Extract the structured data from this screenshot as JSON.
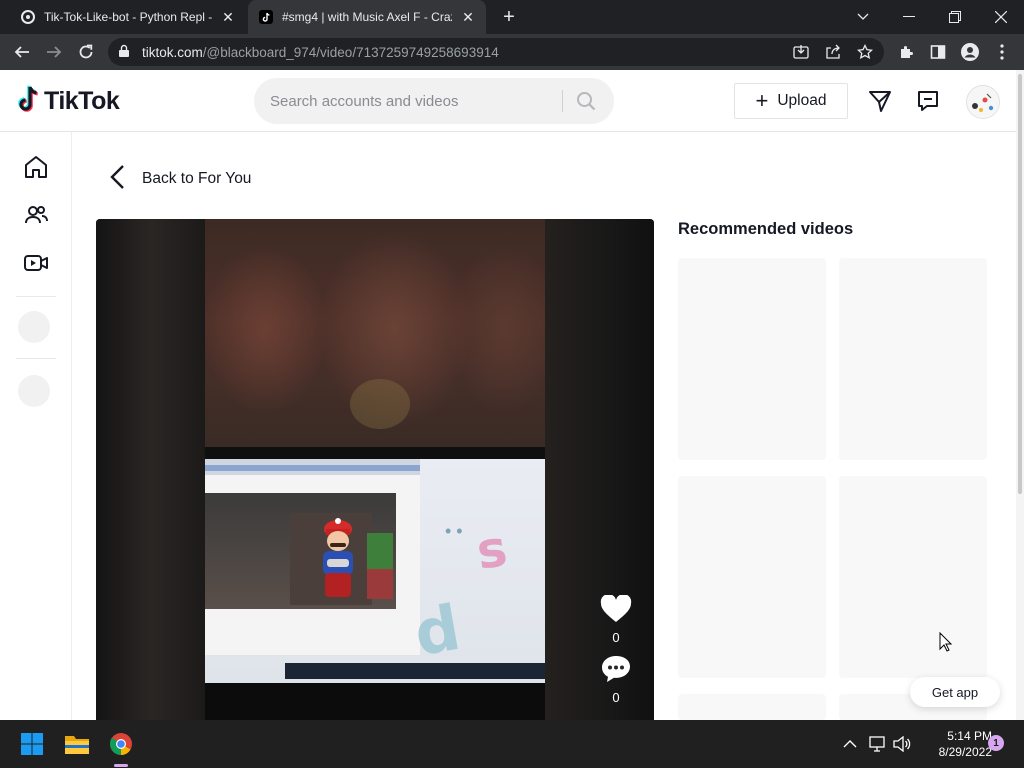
{
  "browser": {
    "tabs": [
      {
        "title": "Tik-Tok-Like-bot - Python Repl -",
        "active": false
      },
      {
        "title": "#smg4 | with Music Axel F - Craz",
        "active": true
      }
    ],
    "url": {
      "host": "tiktok.com",
      "path": "/@blackboard_974/video/7137259749258693914"
    }
  },
  "header": {
    "logo_text": "TikTok",
    "search_placeholder": "Search accounts and videos",
    "upload_label": "Upload"
  },
  "main": {
    "back_label": "Back to For You",
    "like_count": "0",
    "comment_count": "0",
    "recommended_title": "Recommended videos"
  },
  "get_app_label": "Get app",
  "taskbar": {
    "time": "5:14 PM",
    "date": "8/29/2022",
    "notification_count": "1"
  },
  "colors": {
    "tiktok_cyan": "#25f4ee",
    "tiktok_red": "#fe2c55",
    "text_primary": "#161823"
  }
}
